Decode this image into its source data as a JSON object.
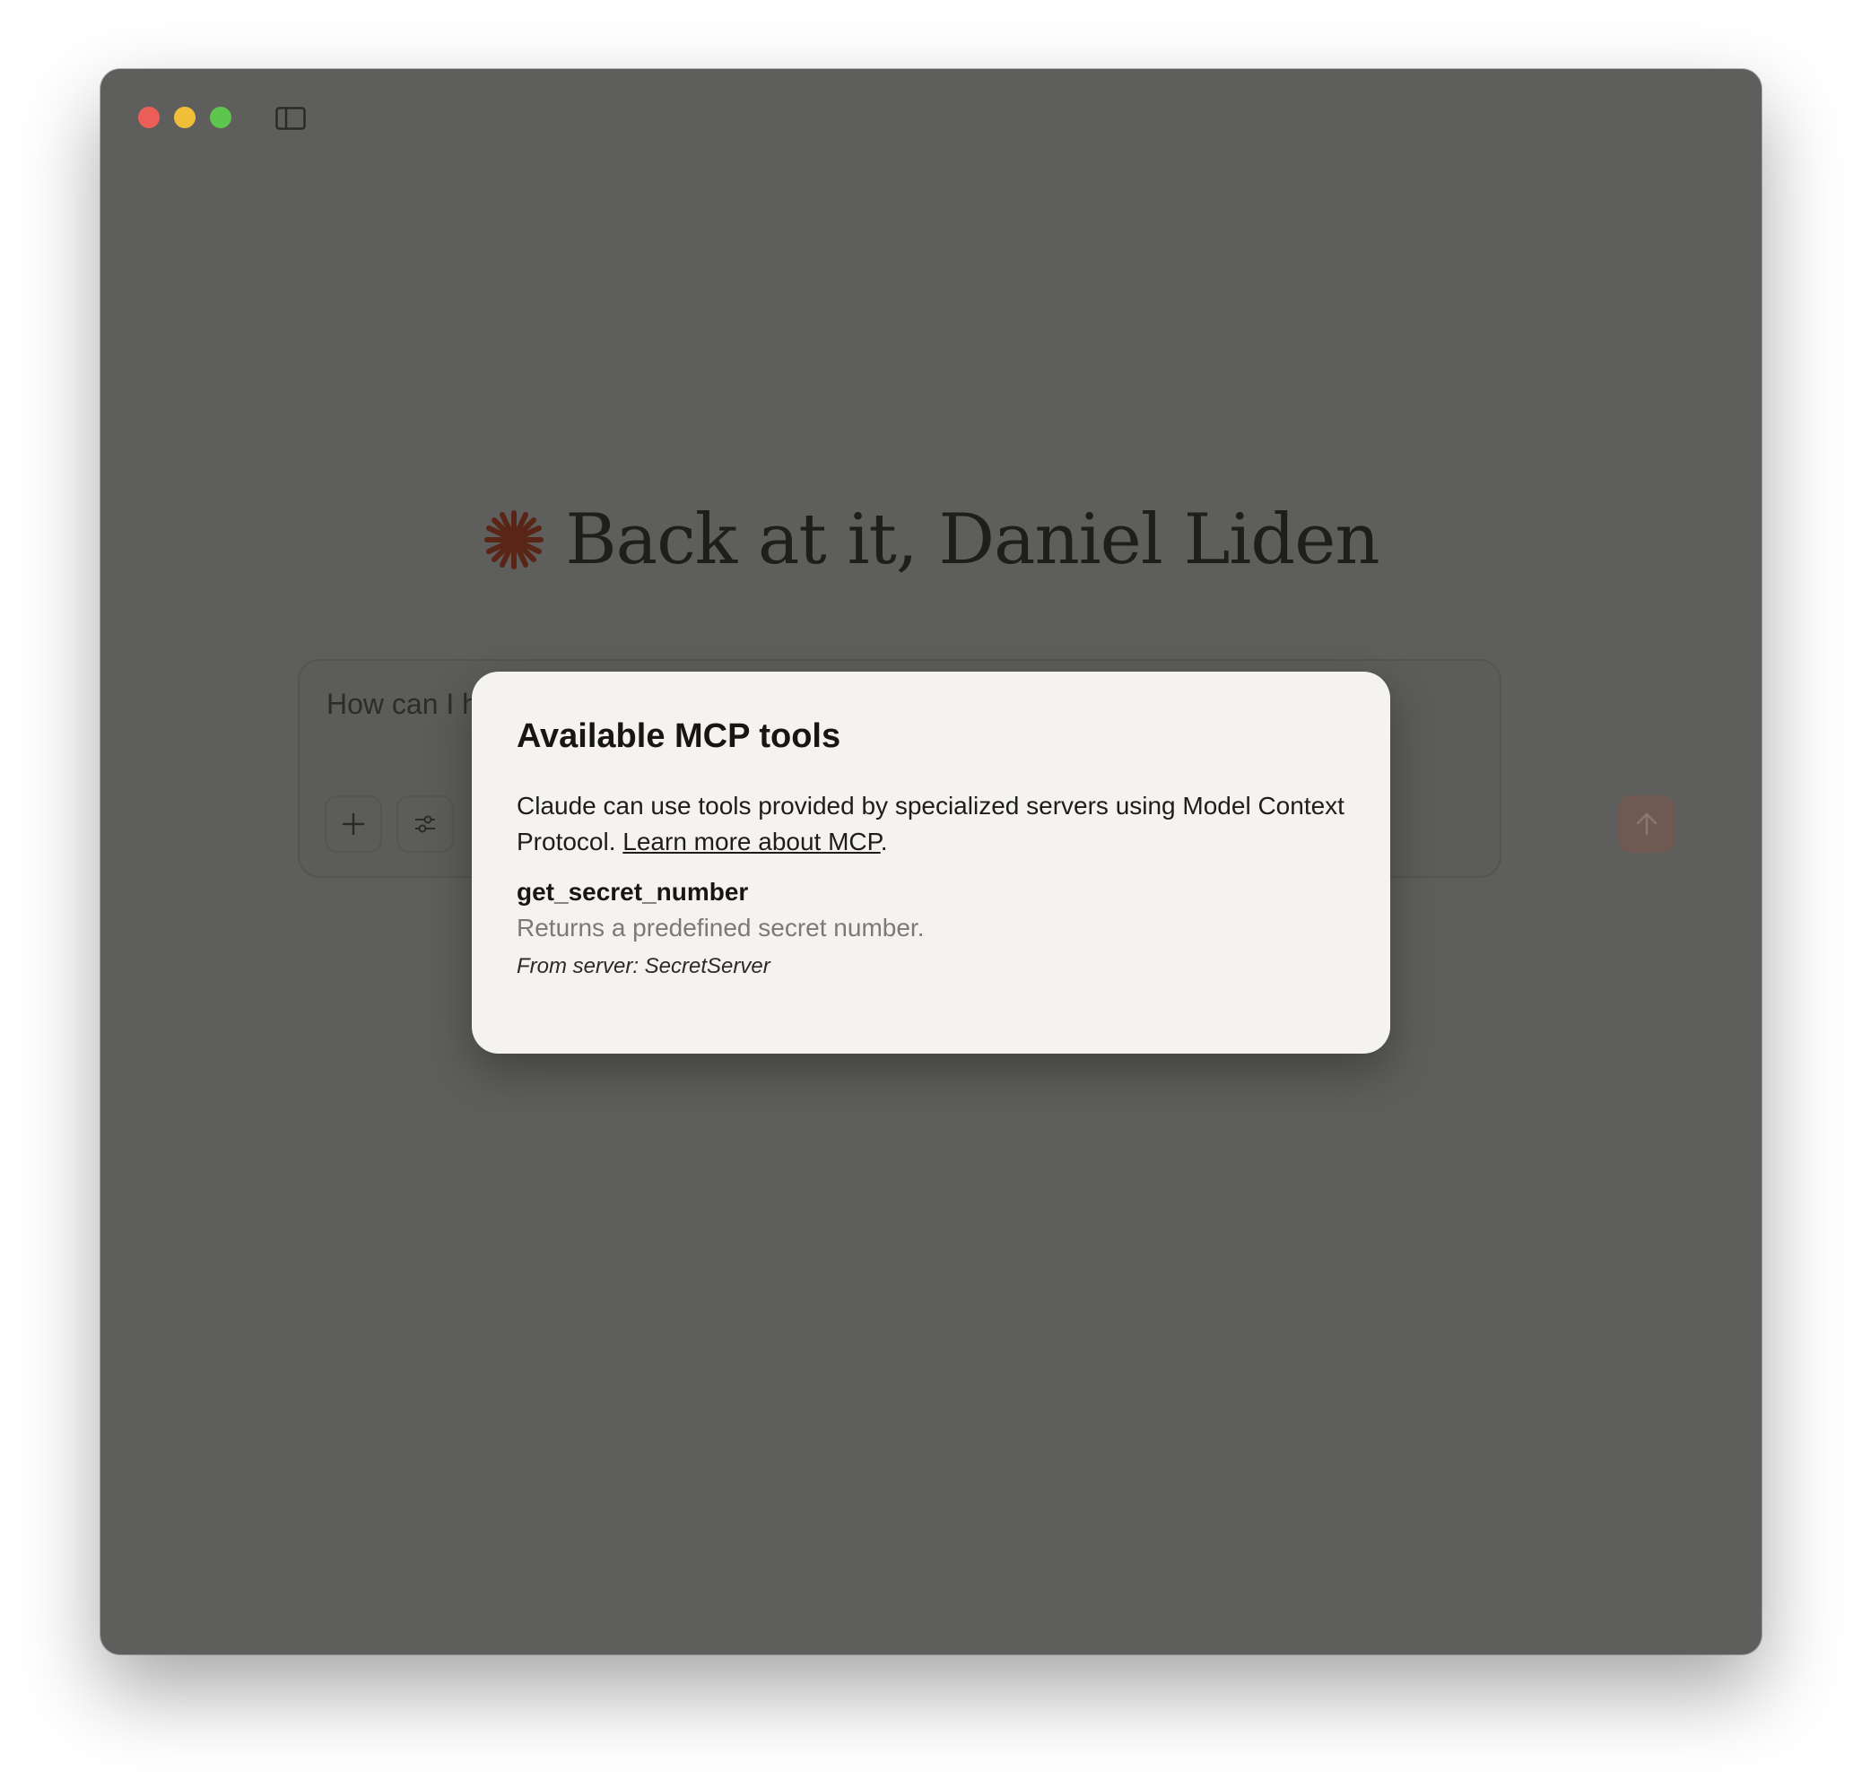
{
  "window": {
    "controls": [
      "close",
      "minimize",
      "maximize"
    ],
    "sidebar_toggle_icon": "sidebar-toggle-icon"
  },
  "greeting": {
    "icon": "claude-spark-icon",
    "text": "Back at it, Daniel Liden"
  },
  "composer": {
    "input_visible_text": "How can I h",
    "buttons": {
      "add_icon": "plus-icon",
      "tools_icon": "sliders-icon",
      "send_icon": "arrow-up-icon"
    }
  },
  "modal": {
    "title": "Available MCP tools",
    "description_prefix": "Claude can use tools provided by specialized servers using Model Context Protocol. ",
    "learn_more_link": "Learn more about MCP",
    "description_suffix": ".",
    "tools": [
      {
        "name": "get_secret_number",
        "description": "Returns a predefined secret number.",
        "server_label": "From server: SecretServer"
      }
    ]
  },
  "colors": {
    "accent": "#c96442",
    "spark": "#6b2c1d",
    "overlay_background": "#5e5e5c",
    "modal_background": "#f4f3ef"
  }
}
